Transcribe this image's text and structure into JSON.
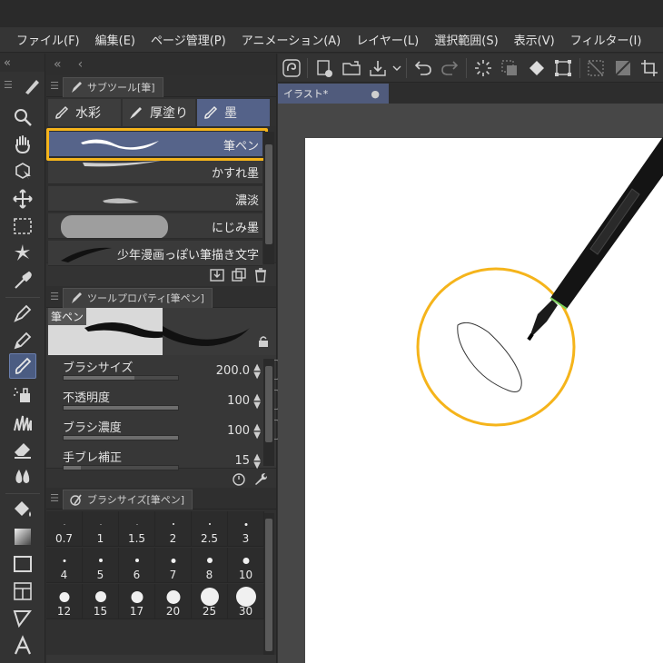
{
  "menu": [
    "ファイル(F)",
    "編集(E)",
    "ページ管理(P)",
    "アニメーション(A)",
    "レイヤー(L)",
    "選択範囲(S)",
    "表示(V)",
    "フィルター(I)"
  ],
  "collapse": {
    "left": "«",
    "mid_left": "«",
    "back": "‹"
  },
  "subtool_panel": {
    "title": "サブツール[筆]",
    "tabs": [
      "水彩",
      "厚塗り",
      "墨"
    ],
    "brushes": [
      "筆ペン",
      "かすれ墨",
      "濃淡",
      "にじみ墨",
      "少年漫画っぽい筆描き文字"
    ]
  },
  "tool_property": {
    "title": "ツールプロパティ[筆ペン]",
    "preview_label": "筆ペン",
    "props": [
      {
        "name": "ブラシサイズ",
        "value": "200.0",
        "fill": 0.62
      },
      {
        "name": "不透明度",
        "value": "100",
        "fill": 1.0
      },
      {
        "name": "ブラシ濃度",
        "value": "100",
        "fill": 1.0
      },
      {
        "name": "手ブレ補正",
        "value": "15",
        "fill": 0.15
      }
    ]
  },
  "brush_size_panel": {
    "title": "ブラシサイズ[筆ペン]",
    "sizes": [
      "0.7",
      "1",
      "1.5",
      "2",
      "2.5",
      "3",
      "4",
      "5",
      "6",
      "7",
      "8",
      "10",
      "12",
      "15",
      "17",
      "20",
      "25",
      "30"
    ]
  },
  "document": {
    "tab_label": "イラスト*",
    "close_glyph": "●"
  },
  "colors": {
    "accent": "#546289",
    "highlight": "#f5b41b",
    "canvas": "#ffffff"
  }
}
